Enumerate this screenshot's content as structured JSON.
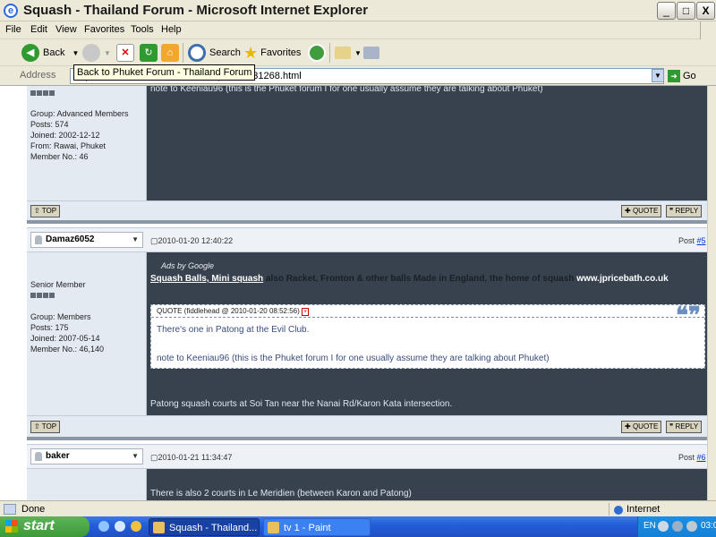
{
  "window": {
    "title": "Squash - Thailand Forum - Microsoft Internet Explorer",
    "min": "_",
    "max": "□",
    "close": "X"
  },
  "menu": [
    "File",
    "Edit",
    "View",
    "Favorites",
    "Tools",
    "Help"
  ],
  "toolbar": {
    "back": "Back",
    "search": "Search",
    "favorites": "Favorites"
  },
  "address": {
    "label": "Address",
    "url": "http://www.thaivisa.com/forum/Squash-t331268.html",
    "go": "Go"
  },
  "tooltip": "Back to Phuket Forum - Thailand Forum",
  "posts": [
    {
      "stars": 4,
      "group": "Group: Advanced Members",
      "posts": "Posts: 574",
      "joined": "Joined: 2002-12-12",
      "from": "From: Rawai, Phuket",
      "member": "Member No.: 46",
      "body": "note to Keeniau96 (this is the Phuket forum I for one usually assume they are talking about Phuket)",
      "top": "TOP",
      "quote": "QUOTE",
      "reply": "REPLY"
    },
    {
      "user": "Damaz6052",
      "date": "2010-01-20 12:40:22",
      "post_label": "Post",
      "post_num": "#5",
      "rank": "Senior Member",
      "stars": 4,
      "group": "Group: Members",
      "posts": "Posts: 175",
      "joined": "Joined: 2007-05-14",
      "member": "Member No.: 46,140",
      "ads_label": "Ads by Google",
      "ad_link": "Squash Balls, Mini squash",
      "ad_text": "also Racket, Fronton & other balls Made in England, the home of squash",
      "ad_url": "www.jpricebath.co.uk",
      "quote_head": "QUOTE (fiddlehead @ 2010-01-20 08:52:56)",
      "quote_line1": "There's one in Patong at the Evil Club.",
      "quote_line2": "note to Keeniau96 (this is the Phuket forum I for one usually assume they are talking about Phuket)",
      "body": "Patong squash courts at Soi Tan near the Nanai Rd/Karon Kata intersection.",
      "top": "TOP",
      "quote": "QUOTE",
      "reply": "REPLY"
    },
    {
      "user": "baker",
      "date": "2010-01-21 11:34:47",
      "post_label": "Post",
      "post_num": "#6",
      "body": "There is also 2 courts in Le Meridien (between Karon and Patong)"
    }
  ],
  "status": {
    "text": "Done",
    "zone": "Internet"
  },
  "taskbar": {
    "start": "start",
    "tasks": [
      "Squash - Thailand...",
      "tv 1 - Paint"
    ],
    "lang": "EN",
    "clock": "03:0"
  }
}
